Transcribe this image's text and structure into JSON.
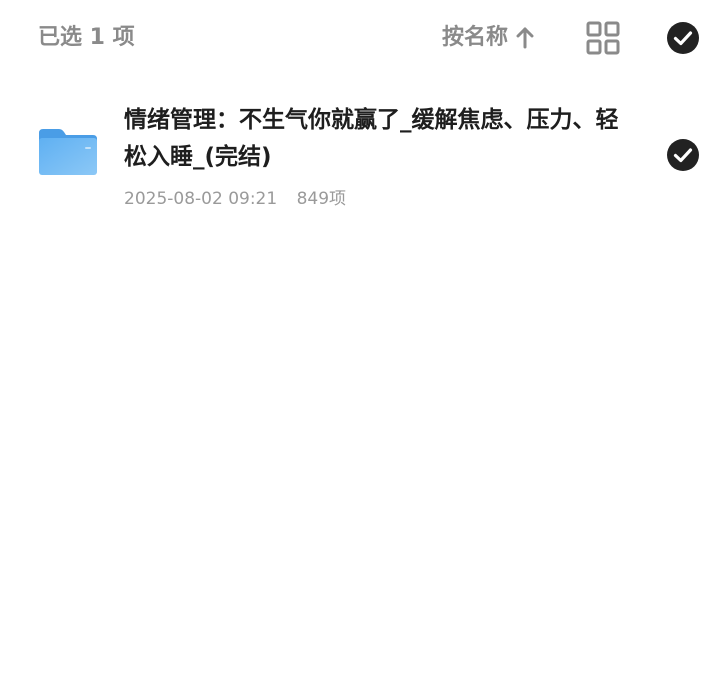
{
  "toolbar": {
    "selected_label": "已选 1 项",
    "sort_label": "按名称",
    "sort_icon": "arrow-up-icon",
    "grid_icon": "grid-view-icon",
    "select_all_icon": "check-circle-icon"
  },
  "files": [
    {
      "icon": "folder-icon",
      "name": "情绪管理：不生气你就赢了_缓解焦虑、压力、轻松入睡_(完结)",
      "date": "2025-08-02 09:21",
      "count": "849项",
      "selected": true
    }
  ],
  "colors": {
    "text_primary": "#1e1e1e",
    "text_secondary": "#8a8a8a",
    "check_fill": "#222222",
    "folder_blue": "#5aa9ee"
  }
}
